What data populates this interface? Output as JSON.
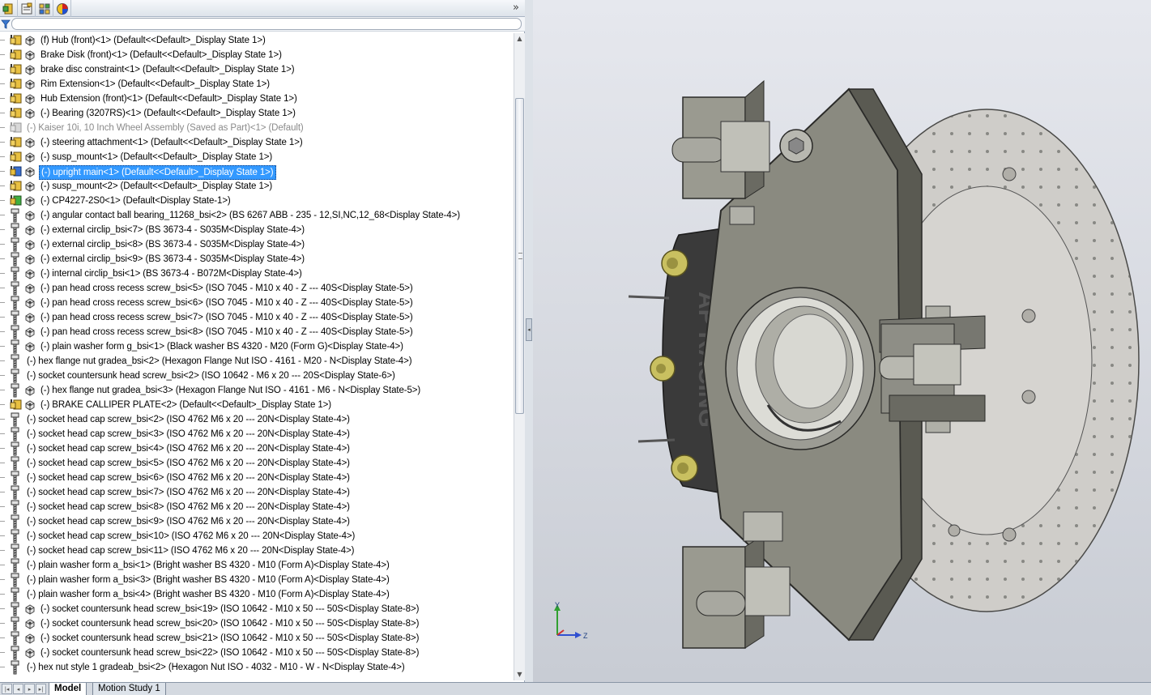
{
  "colors": {
    "selection": "#3399ff",
    "viewport_top": "#e6e8ee",
    "viewport_bottom": "#c8ccd4",
    "part_dark": "#5a5a52",
    "part_mid": "#8a8a80",
    "disk": "#c8c6c2",
    "bolt_gold": "#c9c060",
    "caliper": "#3a3a3a"
  },
  "manager_tabs": [
    {
      "icon": "feature-manager-icon"
    },
    {
      "icon": "property-manager-icon"
    },
    {
      "icon": "configuration-manager-icon"
    },
    {
      "icon": "display-manager-icon"
    }
  ],
  "expand_glyph": "»",
  "filter": {
    "value": "",
    "placeholder": ""
  },
  "tree_items": [
    {
      "label": "(f) Hub (front)<1> (Default<<Default>_Display State 1>)",
      "icon": "assembly-icon",
      "has_display_icon": true
    },
    {
      "label": "Brake Disk (front)<1> (Default<<Default>_Display State 1>)",
      "icon": "assembly-icon",
      "has_display_icon": true
    },
    {
      "label": "brake disc constraint<1> (Default<<Default>_Display State 1>)",
      "icon": "assembly-icon",
      "has_display_icon": true
    },
    {
      "label": "Rim Extension<1> (Default<<Default>_Display State 1>)",
      "icon": "assembly-icon",
      "has_display_icon": true
    },
    {
      "label": "Hub Extension (front)<1> (Default<<Default>_Display State 1>)",
      "icon": "assembly-icon",
      "has_display_icon": true
    },
    {
      "label": "(-) Bearing (3207RS)<1> (Default<<Default>_Display State 1>)",
      "icon": "assembly-icon",
      "has_display_icon": true
    },
    {
      "label": "(-) Kaiser 10i, 10 Inch Wheel Assembly (Saved as Part)<1> (Default)",
      "icon": "suppressed-icon",
      "has_display_icon": false,
      "dim": true
    },
    {
      "label": "(-) steering attachment<1> (Default<<Default>_Display State 1>)",
      "icon": "assembly-icon",
      "has_display_icon": true
    },
    {
      "label": "(-) susp_mount<1> (Default<<Default>_Display State 1>)",
      "icon": "assembly-icon",
      "has_display_icon": true
    },
    {
      "label": "(-) upright main<1> (Default<<Default>_Display State 1>)",
      "icon": "assembly-selected-icon",
      "has_display_icon": true,
      "selected": true
    },
    {
      "label": "(-) susp_mount<2> (Default<<Default>_Display State 1>)",
      "icon": "assembly-icon",
      "has_display_icon": true
    },
    {
      "label": "(-) CP4227-2S0<1> (Default<Display State-1>)",
      "icon": "assembly-green-icon",
      "has_display_icon": true
    },
    {
      "label": "(-) angular contact ball bearing_11268_bsi<2> (BS 6267 ABB - 235 - 12,SI,NC,12_68<Display State-4>)",
      "icon": "toolbox-part-icon",
      "has_display_icon": true
    },
    {
      "label": "(-) external circlip_bsi<7> (BS 3673-4 - S035M<Display State-4>)",
      "icon": "toolbox-part-icon",
      "has_display_icon": true
    },
    {
      "label": "(-) external circlip_bsi<8> (BS 3673-4 - S035M<Display State-4>)",
      "icon": "toolbox-part-icon",
      "has_display_icon": true
    },
    {
      "label": "(-) external circlip_bsi<9> (BS 3673-4 - S035M<Display State-4>)",
      "icon": "toolbox-part-icon",
      "has_display_icon": true
    },
    {
      "label": "(-) internal circlip_bsi<1> (BS 3673-4 - B072M<Display State-4>)",
      "icon": "toolbox-part-icon",
      "has_display_icon": true
    },
    {
      "label": "(-) pan head cross recess screw_bsi<5> (ISO 7045 - M10 x 40 - Z --- 40S<Display State-5>)",
      "icon": "toolbox-part-icon",
      "has_display_icon": true
    },
    {
      "label": "(-) pan head cross recess screw_bsi<6> (ISO 7045 - M10 x 40 - Z --- 40S<Display State-5>)",
      "icon": "toolbox-part-icon",
      "has_display_icon": true
    },
    {
      "label": "(-) pan head cross recess screw_bsi<7> (ISO 7045 - M10 x 40 - Z --- 40S<Display State-5>)",
      "icon": "toolbox-part-icon",
      "has_display_icon": true
    },
    {
      "label": "(-) pan head cross recess screw_bsi<8> (ISO 7045 - M10 x 40 - Z --- 40S<Display State-5>)",
      "icon": "toolbox-part-icon",
      "has_display_icon": true
    },
    {
      "label": "(-) plain washer form g_bsi<1> (Black washer BS 4320 - M20 (Form G)<Display State-4>)",
      "icon": "toolbox-part-icon",
      "has_display_icon": true
    },
    {
      "label": "(-) hex flange nut gradea_bsi<2> (Hexagon Flange Nut ISO - 4161 - M20 - N<Display State-4>)",
      "icon": "toolbox-part-icon",
      "has_display_icon": false
    },
    {
      "label": "(-) socket countersunk head screw_bsi<2> (ISO 10642 - M6 x 20 --- 20S<Display State-6>)",
      "icon": "toolbox-part-icon",
      "has_display_icon": false
    },
    {
      "label": "(-) hex flange nut gradea_bsi<3> (Hexagon Flange Nut ISO - 4161 - M6 - N<Display State-5>)",
      "icon": "toolbox-part-icon",
      "has_display_icon": true
    },
    {
      "label": "(-) BRAKE CALLIPER PLATE<2> (Default<<Default>_Display State 1>)",
      "icon": "assembly-icon",
      "has_display_icon": true
    },
    {
      "label": "(-) socket head cap screw_bsi<2> (ISO 4762 M6 x 20 --- 20N<Display State-4>)",
      "icon": "toolbox-part-icon",
      "has_display_icon": false
    },
    {
      "label": "(-) socket head cap screw_bsi<3> (ISO 4762 M6 x 20 --- 20N<Display State-4>)",
      "icon": "toolbox-part-icon",
      "has_display_icon": false
    },
    {
      "label": "(-) socket head cap screw_bsi<4> (ISO 4762 M6 x 20 --- 20N<Display State-4>)",
      "icon": "toolbox-part-icon",
      "has_display_icon": false
    },
    {
      "label": "(-) socket head cap screw_bsi<5> (ISO 4762 M6 x 20 --- 20N<Display State-4>)",
      "icon": "toolbox-part-icon",
      "has_display_icon": false
    },
    {
      "label": "(-) socket head cap screw_bsi<6> (ISO 4762 M6 x 20 --- 20N<Display State-4>)",
      "icon": "toolbox-part-icon",
      "has_display_icon": false
    },
    {
      "label": "(-) socket head cap screw_bsi<7> (ISO 4762 M6 x 20 --- 20N<Display State-4>)",
      "icon": "toolbox-part-icon",
      "has_display_icon": false
    },
    {
      "label": "(-) socket head cap screw_bsi<8> (ISO 4762 M6 x 20 --- 20N<Display State-4>)",
      "icon": "toolbox-part-icon",
      "has_display_icon": false
    },
    {
      "label": "(-) socket head cap screw_bsi<9> (ISO 4762 M6 x 20 --- 20N<Display State-4>)",
      "icon": "toolbox-part-icon",
      "has_display_icon": false
    },
    {
      "label": "(-) socket head cap screw_bsi<10> (ISO 4762 M6 x 20 --- 20N<Display State-4>)",
      "icon": "toolbox-part-icon",
      "has_display_icon": false
    },
    {
      "label": "(-) socket head cap screw_bsi<11> (ISO 4762 M6 x 20 --- 20N<Display State-4>)",
      "icon": "toolbox-part-icon",
      "has_display_icon": false
    },
    {
      "label": "(-) plain washer form a_bsi<1> (Bright washer BS 4320 - M10 (Form A)<Display State-4>)",
      "icon": "toolbox-part-icon",
      "has_display_icon": false
    },
    {
      "label": "(-) plain washer form a_bsi<3> (Bright washer BS 4320 - M10 (Form A)<Display State-4>)",
      "icon": "toolbox-part-icon",
      "has_display_icon": false
    },
    {
      "label": "(-) plain washer form a_bsi<4> (Bright washer BS 4320 - M10 (Form A)<Display State-4>)",
      "icon": "toolbox-part-icon",
      "has_display_icon": false
    },
    {
      "label": "(-) socket countersunk head screw_bsi<19> (ISO 10642 - M10 x 50 --- 50S<Display State-8>)",
      "icon": "toolbox-part-icon",
      "has_display_icon": true
    },
    {
      "label": "(-) socket countersunk head screw_bsi<20> (ISO 10642 - M10 x 50 --- 50S<Display State-8>)",
      "icon": "toolbox-part-icon",
      "has_display_icon": true
    },
    {
      "label": "(-) socket countersunk head screw_bsi<21> (ISO 10642 - M10 x 50 --- 50S<Display State-8>)",
      "icon": "toolbox-part-icon",
      "has_display_icon": true
    },
    {
      "label": "(-) socket countersunk head screw_bsi<22> (ISO 10642 - M10 x 50 --- 50S<Display State-8>)",
      "icon": "toolbox-part-icon",
      "has_display_icon": true
    },
    {
      "label": "(-) hex nut style 1 gradeab_bsi<2> (Hexagon Nut ISO - 4032 - M10 - W - N<Display State-4>)",
      "icon": "toolbox-part-icon",
      "has_display_icon": false
    }
  ],
  "bottom_tabs": [
    {
      "label": "Model",
      "active": true
    },
    {
      "label": "Motion Study 1",
      "active": false
    }
  ],
  "triad": {
    "y_label": "Y",
    "z_label": "Z"
  },
  "caliper_text": "AP RACING"
}
